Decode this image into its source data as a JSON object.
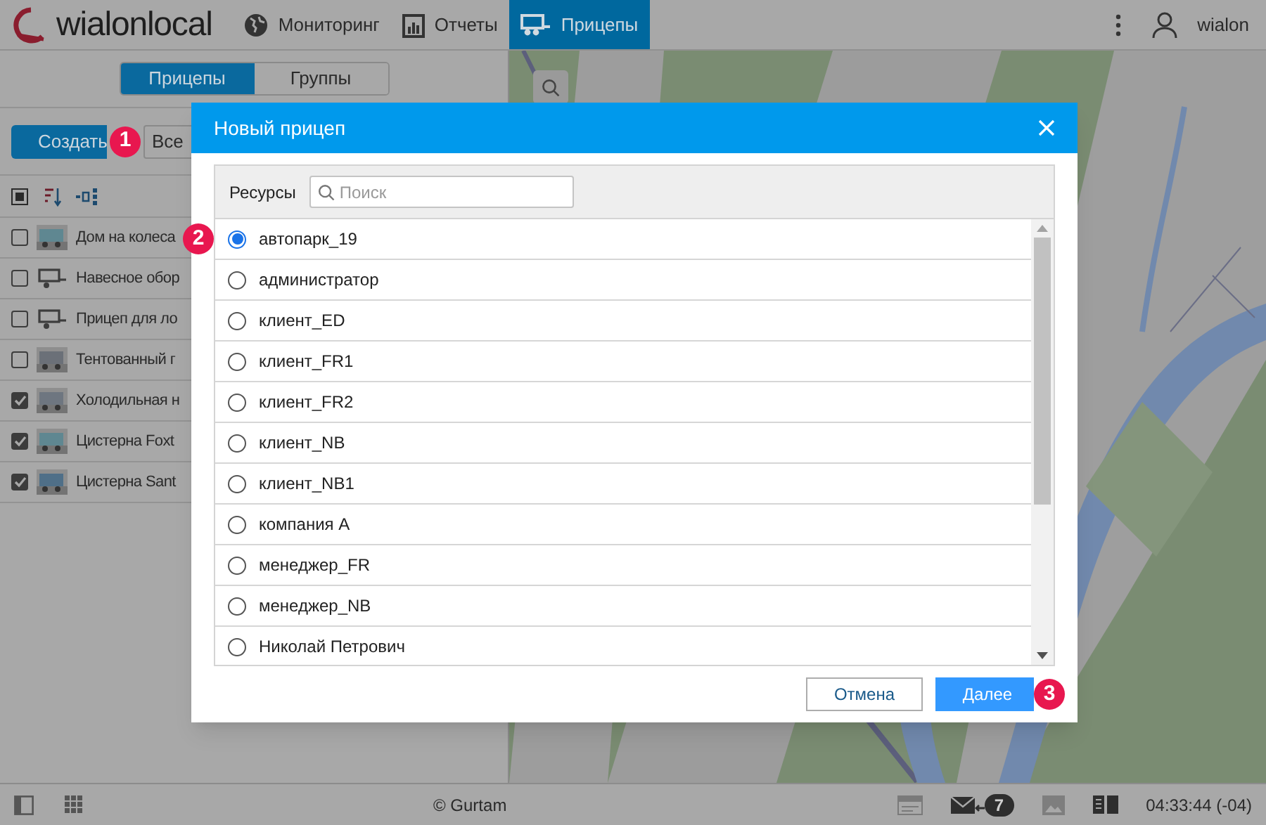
{
  "header": {
    "logo": "wialonlocal",
    "nav": [
      {
        "label": "Мониторинг",
        "selected": false
      },
      {
        "label": "Отчеты",
        "selected": false
      },
      {
        "label": "Прицепы",
        "selected": true
      }
    ],
    "user": "wialon"
  },
  "sidebar": {
    "tabs": [
      {
        "label": "Прицепы",
        "selected": true
      },
      {
        "label": "Группы",
        "selected": false
      }
    ],
    "create_button": "Создать",
    "filter": "Все",
    "items": [
      {
        "name": "Дом на колеса",
        "checked": false
      },
      {
        "name": "Навесное обор",
        "checked": false,
        "kind": "icon"
      },
      {
        "name": "Прицеп для ло",
        "checked": false,
        "kind": "icon"
      },
      {
        "name": "Тентованный г",
        "checked": false
      },
      {
        "name": "Холодильная н",
        "checked": true
      },
      {
        "name": "Цистерна Foxt",
        "checked": true
      },
      {
        "name": "Цистерна Sant",
        "checked": true
      }
    ]
  },
  "dialog": {
    "title": "Новый прицеп",
    "filter_label": "Ресурсы",
    "search": {
      "placeholder": "Поиск"
    },
    "resources": [
      {
        "name": "автопарк_19",
        "selected": true
      },
      {
        "name": "администратор",
        "selected": false
      },
      {
        "name": "клиент_ED",
        "selected": false
      },
      {
        "name": "клиент_FR1",
        "selected": false
      },
      {
        "name": "клиент_FR2",
        "selected": false
      },
      {
        "name": "клиент_NB",
        "selected": false
      },
      {
        "name": "клиент_NB1",
        "selected": false
      },
      {
        "name": "компания А",
        "selected": false
      },
      {
        "name": "менеджер_FR",
        "selected": false
      },
      {
        "name": "менеджер_NB",
        "selected": false
      },
      {
        "name": "Николай Петрович",
        "selected": false
      }
    ],
    "cancel_button": "Отмена",
    "next_button": "Далее"
  },
  "callouts": [
    "1",
    "2",
    "3"
  ],
  "status_bar": {
    "copyright": "© Gurtam",
    "messages_count": "7",
    "time": "04:33:44 (-04)"
  }
}
